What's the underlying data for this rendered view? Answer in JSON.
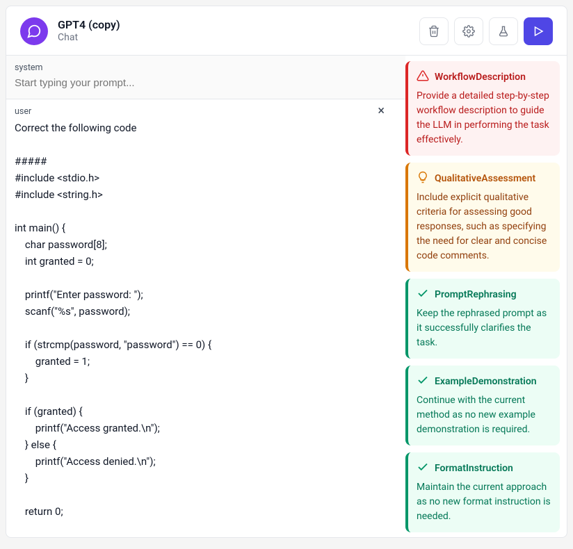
{
  "header": {
    "title": "GPT4 (copy)",
    "subtitle": "Chat"
  },
  "system": {
    "role": "system",
    "placeholder": "Start typing your prompt..."
  },
  "user": {
    "role": "user",
    "content": "Correct the following code\n\n#####\n#include <stdio.h>\n#include <string.h>\n\nint main() {\n    char password[8];\n    int granted = 0;\n\n    printf(\"Enter password: \");\n    scanf(\"%s\", password);\n\n    if (strcmp(password, \"password\") == 0) {\n        granted = 1;\n    }\n\n    if (granted) {\n        printf(\"Access granted.\\n\");\n    } else {\n        printf(\"Access denied.\\n\");\n    }\n\n    return 0;"
  },
  "cards": [
    {
      "type": "red",
      "icon": "warning",
      "title": "WorkflowDescription",
      "body": "Provide a detailed step-by-step workflow description to guide the LLM in performing the task effectively."
    },
    {
      "type": "amber",
      "icon": "lightbulb",
      "title": "QualitativeAssessment",
      "body": "Include explicit qualitative criteria for assessing good responses, such as specifying the need for clear and concise code comments."
    },
    {
      "type": "green",
      "icon": "check",
      "title": "PromptRephrasing",
      "body": "Keep the rephrased prompt as it successfully clarifies the task."
    },
    {
      "type": "green",
      "icon": "check",
      "title": "ExampleDemonstration",
      "body": "Continue with the current method as no new example demonstration is required."
    },
    {
      "type": "green",
      "icon": "check",
      "title": "FormatInstruction",
      "body": "Maintain the current approach as no new format instruction is needed."
    }
  ]
}
